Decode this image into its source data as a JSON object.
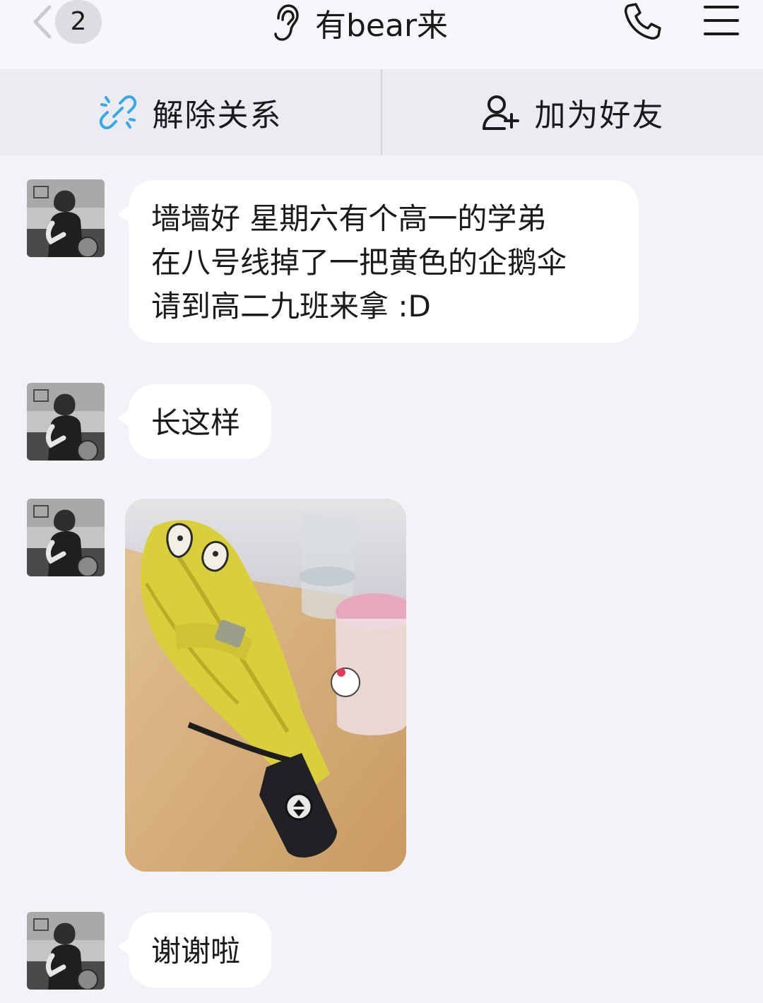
{
  "header": {
    "unread_count": "2",
    "title": "有bear来",
    "icons": {
      "back": "chevron-left-icon",
      "mode": "ear-icon",
      "call": "phone-icon",
      "menu": "hamburger-menu-icon"
    }
  },
  "actions": {
    "unlink_label": "解除关系",
    "add_friend_label": "加为好友",
    "unlink_icon": "broken-link-icon",
    "add_friend_icon": "add-user-icon",
    "unlink_icon_color": "#3aa7e8"
  },
  "messages": [
    {
      "type": "text",
      "lines": [
        "墙墙好 星期六有个高一的学弟",
        "在八号线掉了一把黄色的企鹅伞",
        "请到高二九班来拿 :D"
      ]
    },
    {
      "type": "text",
      "lines": [
        "长这样"
      ]
    },
    {
      "type": "image",
      "subject": "yellow penguin umbrella on a wooden desk"
    },
    {
      "type": "text",
      "lines": [
        "谢谢啦"
      ]
    }
  ],
  "colors": {
    "background": "#f2f3f7",
    "bubble": "#ffffff",
    "strip": "#eaecf1"
  }
}
